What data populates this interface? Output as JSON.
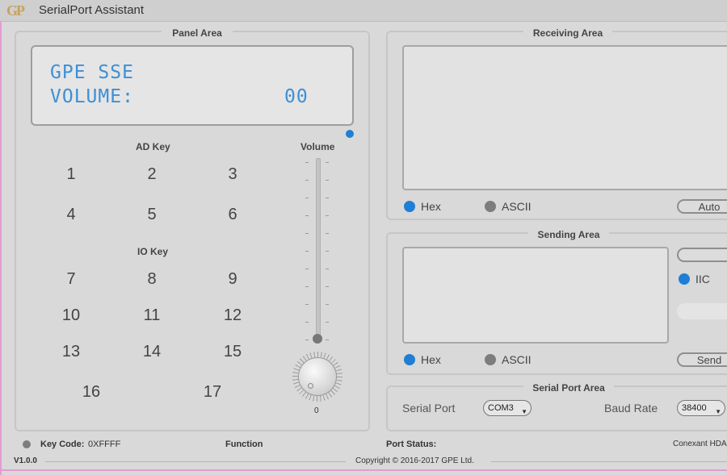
{
  "app": {
    "logo": "GP",
    "title": "SerialPort Assistant"
  },
  "panel_area": {
    "title": "Panel Area",
    "lcd": {
      "line1_label": "GPE SSE",
      "line2_label": "VOLUME:",
      "line2_value": "00"
    },
    "ad_key_title": "AD Key",
    "io_key_title": "IO Key",
    "ad_keys": [
      "1",
      "2",
      "3",
      "4",
      "5",
      "6"
    ],
    "io_keys": [
      "7",
      "8",
      "9",
      "10",
      "11",
      "12",
      "13",
      "14",
      "15",
      "16",
      "17"
    ],
    "volume": {
      "label": "Volume",
      "value": "0",
      "level": 0
    }
  },
  "receiving_area": {
    "title": "Receiving Area",
    "hex_label": "Hex",
    "ascii_label": "ASCII",
    "selected": "Hex",
    "auto_button": "Auto"
  },
  "sending_area": {
    "title": "Sending Area",
    "hex_label": "Hex",
    "ascii_label": "ASCII",
    "selected": "Hex",
    "iic_label": "IIC",
    "send_button": "Send"
  },
  "serial_port_area": {
    "title": "Serial Port Area",
    "port_label": "Serial Port",
    "port_value": "COM3",
    "baud_label": "Baud Rate",
    "baud_value": "38400"
  },
  "status_bar": {
    "key_code_label": "Key Code:",
    "key_code_value": "0XFFFF",
    "function_label": "Function",
    "port_status_label": "Port Status:",
    "device": "Conexant HDA"
  },
  "footer": {
    "version": "V1.0.0",
    "copyright": "Copyright © 2016-2017 GPE Ltd."
  },
  "colors": {
    "accent": "#1e7fd4",
    "lcd_text": "#3d8fd6",
    "logo": "#c8a25a"
  }
}
